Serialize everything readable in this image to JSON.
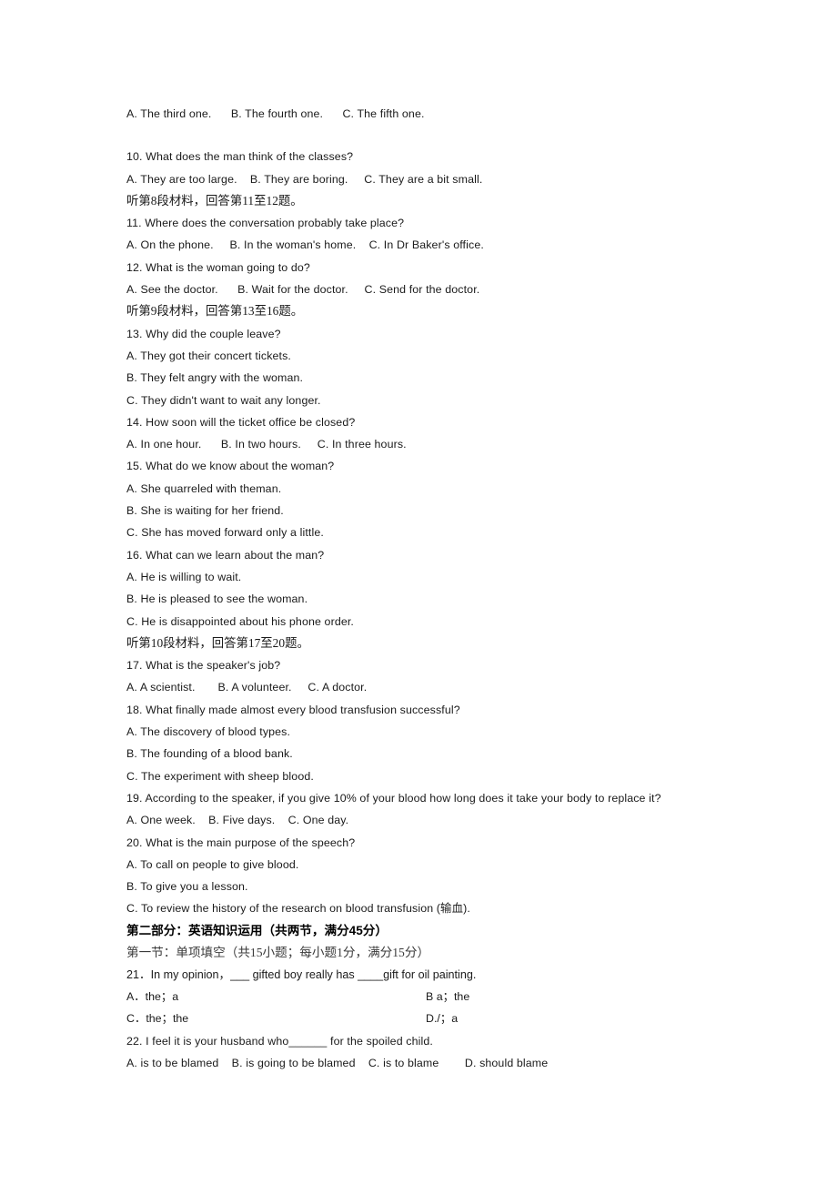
{
  "document": {
    "type": "english-exam-paper",
    "language": "en-zh",
    "page_background": "#ffffff",
    "text_color": "#1a1a1a"
  },
  "listening": {
    "q9_options": "A. The third one.      B. The fourth one.      C. The fifth one.",
    "q10_stem": "10. What does the man think of the classes?",
    "q10_options": "A. They are too large.    B. They are boring.     C. They are a bit small.",
    "inst_material8": "听第8段材料，回答第11至12题。",
    "q11_stem": "11. Where does the conversation probably take place?",
    "q11_options": "A. On the phone.     B. In the woman's home.    C. In Dr Baker's office.",
    "q12_stem": "12. What is the woman going to do?",
    "q12_options": "A. See the doctor.      B. Wait for the doctor.     C. Send for the doctor.",
    "inst_material9": "听第9段材料，回答第13至16题。",
    "q13_stem": "13. Why did the couple leave?",
    "q13_option_a": "A. They got their concert tickets.",
    "q13_option_b": "B. They felt angry with the woman.",
    "q13_option_c": "C. They didn't want to wait any longer.",
    "q14_stem": "14. How soon will the ticket office be closed?",
    "q14_options": "A. In one hour.      B. In two hours.     C. In three hours.",
    "q15_stem": "15. What do we know about the woman?",
    "q15_option_a": "A. She quarreled with theman.",
    "q15_option_b": "B. She is waiting for her friend.",
    "q15_option_c": "C. She has moved forward only a little.",
    "q16_stem": "16. What can we learn about the man?",
    "q16_option_a": "A. He is willing to wait.",
    "q16_option_b": "B. He is pleased to see the woman.",
    "q16_option_c": "C. He is disappointed about his phone order.",
    "inst_material10": "听第10段材料，回答第17至20题。",
    "q17_stem": "17. What is the speaker's job?",
    "q17_options": "A. A scientist.       B. A volunteer.     C. A doctor.",
    "q18_stem": "18. What finally made almost every blood transfusion successful?",
    "q18_option_a": "A. The discovery of blood types.",
    "q18_option_b": "B. The founding of a blood bank.",
    "q18_option_c": "C. The experiment with sheep blood.",
    "q19_stem": "19. According to the speaker, if you give 10% of your blood how long does it take your body to replace it?",
    "q19_options": "A. One week.    B. Five days.    C. One day.",
    "q20_stem": "20. What is the main purpose of the speech?",
    "q20_option_a": "A. To call on people to give blood.",
    "q20_option_b": "B. To give you a lesson.",
    "q20_option_c": "C. To review the history of the research on blood transfusion (输血)."
  },
  "part_two": {
    "heading": "第二部分：英语知识运用（共两节，满分45分）",
    "section_one": "第一节：单项填空（共15小题；每小题1分，满分15分）",
    "q21_stem": "21．In my opinion，___ gifted boy really has ____gift for oil painting.",
    "q21_option_a": "A．the；a",
    "q21_option_b": "B a；the",
    "q21_option_c": "C．the；the",
    "q21_option_d": "D./；a",
    "q22_stem": "22. I feel it is your husband who______ for the spoiled child.",
    "q22_options": "A. is to be blamed    B. is going to be blamed    C. is to blame        D. should blame"
  }
}
